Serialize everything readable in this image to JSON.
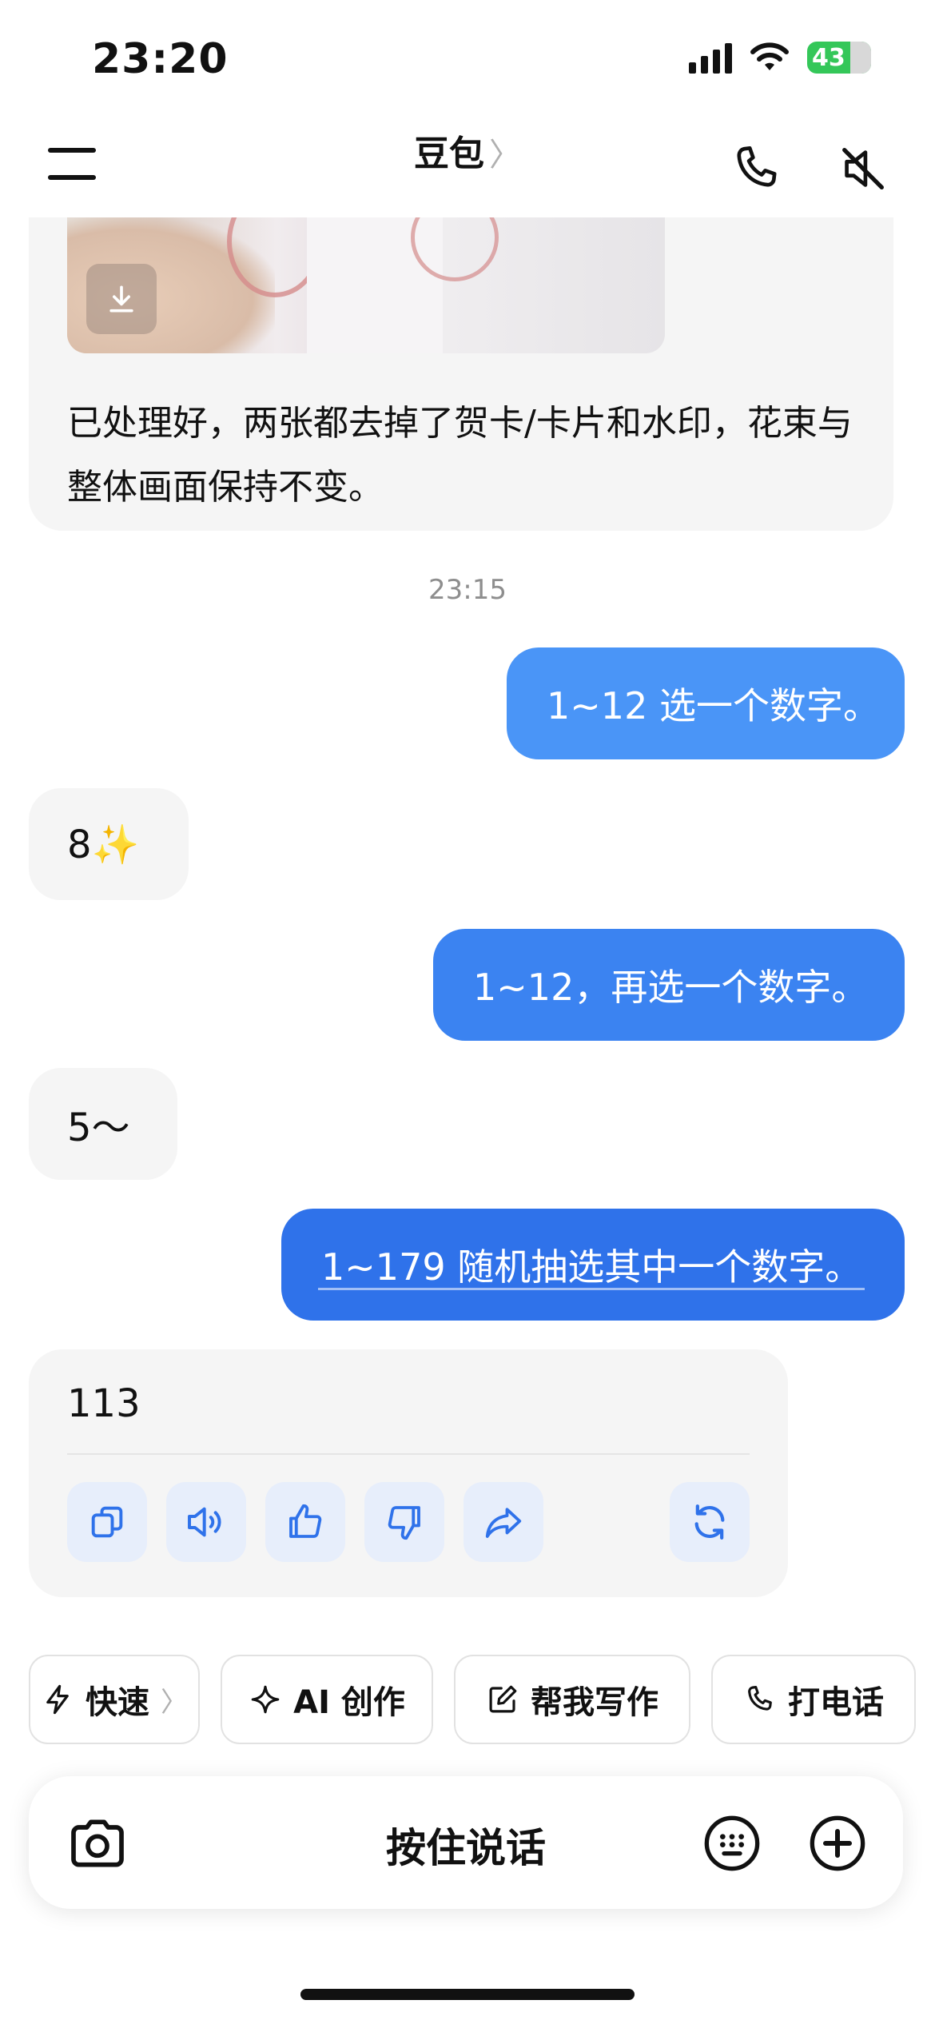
{
  "status_bar": {
    "time": "23:20",
    "battery": "43"
  },
  "nav": {
    "title": "豆包",
    "title_chevron": "〉"
  },
  "image_card": {
    "text": "已处理好，两张都去掉了贺卡/卡片和水印，花束与整体画面保持不变。"
  },
  "timestamp": "23:15",
  "messages": [
    {
      "role": "user",
      "text": "1~12 选一个数字。"
    },
    {
      "role": "bot",
      "text": "8✨"
    },
    {
      "role": "user",
      "text": "1~12，再选一个数字。"
    },
    {
      "role": "bot",
      "text": "5～"
    },
    {
      "role": "user",
      "text": "1~179 随机抽选其中一个数字。"
    }
  ],
  "answer": {
    "text": "113",
    "actions": [
      "copy-icon",
      "speaker-icon",
      "thumbs-up-icon",
      "thumbs-down-icon",
      "share-icon",
      "regenerate-icon"
    ]
  },
  "chips": [
    {
      "label": "快速",
      "icon": "lightning-icon",
      "chevron": "〉"
    },
    {
      "label": "AI 创作",
      "icon": "sparkle-icon"
    },
    {
      "label": "帮我写作",
      "icon": "edit-icon"
    },
    {
      "label": "打电话",
      "icon": "phone-icon"
    }
  ],
  "input_bar": {
    "label": "按住说话"
  },
  "colors": {
    "user_bubble": "#3b83f1",
    "bot_bubble": "#f5f5f5",
    "action_bg": "#e7eefb",
    "accent": "#2f72ea"
  }
}
